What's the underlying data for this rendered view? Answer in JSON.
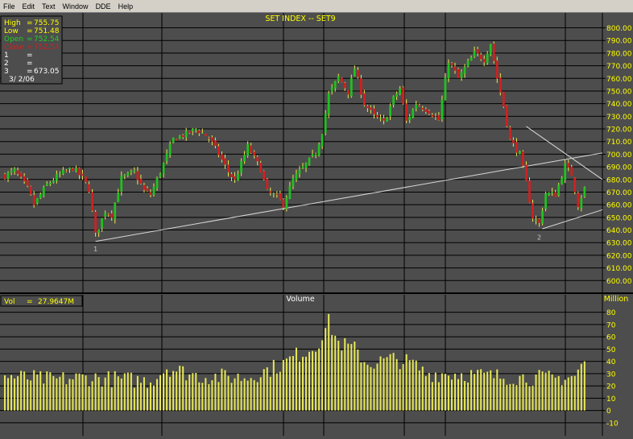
{
  "menu": [
    "File",
    "Edit",
    "Text",
    "Window",
    "DDE",
    "Help"
  ],
  "colors": {
    "background": "#4d4d4d",
    "grid": "#000000",
    "axis_text": "#ffff00",
    "up": "#20c020",
    "down": "#d02020",
    "volume": "#e8e85a",
    "trendline": "#d8d8d8"
  },
  "chart_data": [
    {
      "type": "candlestick",
      "title": "SET INDEX -- SET9",
      "ylim": [
        590,
        808
      ],
      "yticks": [
        600,
        610,
        620,
        630,
        640,
        650,
        660,
        670,
        680,
        690,
        700,
        710,
        720,
        730,
        740,
        750,
        760,
        770,
        780,
        790,
        800
      ],
      "ytick_labels": [
        "600.00",
        "610.00",
        "620.00",
        "630.00",
        "640.00",
        "650.00",
        "660.00",
        "670.00",
        "680.00",
        "690.00",
        "700.00",
        "710.00",
        "720.00",
        "730.00",
        "740.00",
        "750.00",
        "760.00",
        "770.00",
        "780.00",
        "790.00",
        "800.00"
      ],
      "grid": true,
      "n_bars": 180,
      "close_path": [
        [
          0,
          683
        ],
        [
          3,
          687
        ],
        [
          7,
          673
        ],
        [
          9,
          660
        ],
        [
          13,
          676
        ],
        [
          17,
          684
        ],
        [
          21,
          689
        ],
        [
          24,
          681
        ],
        [
          26,
          672
        ],
        [
          28,
          636
        ],
        [
          31,
          655
        ],
        [
          33,
          652
        ],
        [
          36,
          681
        ],
        [
          40,
          686
        ],
        [
          43,
          671
        ],
        [
          45,
          668
        ],
        [
          48,
          686
        ],
        [
          52,
          712
        ],
        [
          56,
          716
        ],
        [
          59,
          720
        ],
        [
          63,
          713
        ],
        [
          66,
          700
        ],
        [
          69,
          686
        ],
        [
          71,
          679
        ],
        [
          75,
          706
        ],
        [
          79,
          688
        ],
        [
          81,
          670
        ],
        [
          84,
          666
        ],
        [
          86,
          660
        ],
        [
          89,
          680
        ],
        [
          92,
          689
        ],
        [
          96,
          701
        ],
        [
          98,
          718
        ],
        [
          100,
          747
        ],
        [
          103,
          761
        ],
        [
          106,
          749
        ],
        [
          108,
          768
        ],
        [
          111,
          740
        ],
        [
          114,
          730
        ],
        [
          117,
          725
        ],
        [
          120,
          744
        ],
        [
          122,
          752
        ],
        [
          124,
          726
        ],
        [
          127,
          740
        ],
        [
          131,
          734
        ],
        [
          134,
          727
        ],
        [
          137,
          774
        ],
        [
          140,
          760
        ],
        [
          142,
          768
        ],
        [
          145,
          780
        ],
        [
          148,
          775
        ],
        [
          150,
          788
        ],
        [
          152,
          760
        ],
        [
          154,
          738
        ],
        [
          156,
          711
        ],
        [
          159,
          700
        ],
        [
          161,
          677
        ],
        [
          163,
          650
        ],
        [
          165,
          645
        ],
        [
          167,
          669
        ],
        [
          170,
          668
        ],
        [
          173,
          691
        ],
        [
          175,
          684
        ],
        [
          177,
          660
        ],
        [
          179,
          673
        ]
      ],
      "swing_labels": [
        {
          "label": "1",
          "bar": 28
        },
        {
          "label": "2",
          "bar": 165
        }
      ],
      "legend": [
        {
          "label": "High",
          "value": "755.75",
          "color": "#ffff00"
        },
        {
          "label": "Low",
          "value": "751.48",
          "color": "#ffff00"
        },
        {
          "label": "Open",
          "value": "752.54",
          "color": "#20d020"
        },
        {
          "label": "Close",
          "value": "752.54",
          "color": "#d02020"
        },
        {
          "label": "1",
          "value": "",
          "color": "#ffffff"
        },
        {
          "label": "2",
          "value": "",
          "color": "#ffffff"
        },
        {
          "label": "3",
          "value": "673.05",
          "color": "#ffffff"
        }
      ],
      "cursor_date": "3/ 2/06",
      "trendlines": [
        {
          "from": [
            28,
            631
          ],
          "to": [
            185,
            701
          ]
        },
        {
          "from": [
            166,
            641
          ],
          "to": [
            185,
            656
          ]
        },
        {
          "from": [
            161,
            722
          ],
          "to": [
            185,
            680
          ]
        }
      ]
    },
    {
      "type": "bar",
      "title": "Volume",
      "legend_label": "Vol",
      "legend_value": "27.9647M",
      "unit_label": "Million",
      "ylim": [
        -14,
        85
      ],
      "yticks": [
        -10,
        0,
        10,
        20,
        30,
        40,
        50,
        60,
        70,
        80
      ],
      "ytick_labels": [
        "-10",
        "0",
        "10",
        "20",
        "30",
        "40",
        "50",
        "60",
        "70",
        "80"
      ],
      "grid": true,
      "n_bars": 180,
      "volume_path": [
        [
          0,
          28
        ],
        [
          15,
          25
        ],
        [
          25,
          27
        ],
        [
          45,
          24
        ],
        [
          50,
          35
        ],
        [
          60,
          28
        ],
        [
          75,
          27
        ],
        [
          86,
          38
        ],
        [
          90,
          45
        ],
        [
          96,
          52
        ],
        [
          100,
          72
        ],
        [
          103,
          55
        ],
        [
          108,
          50
        ],
        [
          112,
          38
        ],
        [
          120,
          42
        ],
        [
          126,
          38
        ],
        [
          130,
          30
        ],
        [
          140,
          30
        ],
        [
          150,
          28
        ],
        [
          160,
          27
        ],
        [
          170,
          26
        ],
        [
          176,
          28
        ],
        [
          179,
          40
        ]
      ]
    }
  ]
}
